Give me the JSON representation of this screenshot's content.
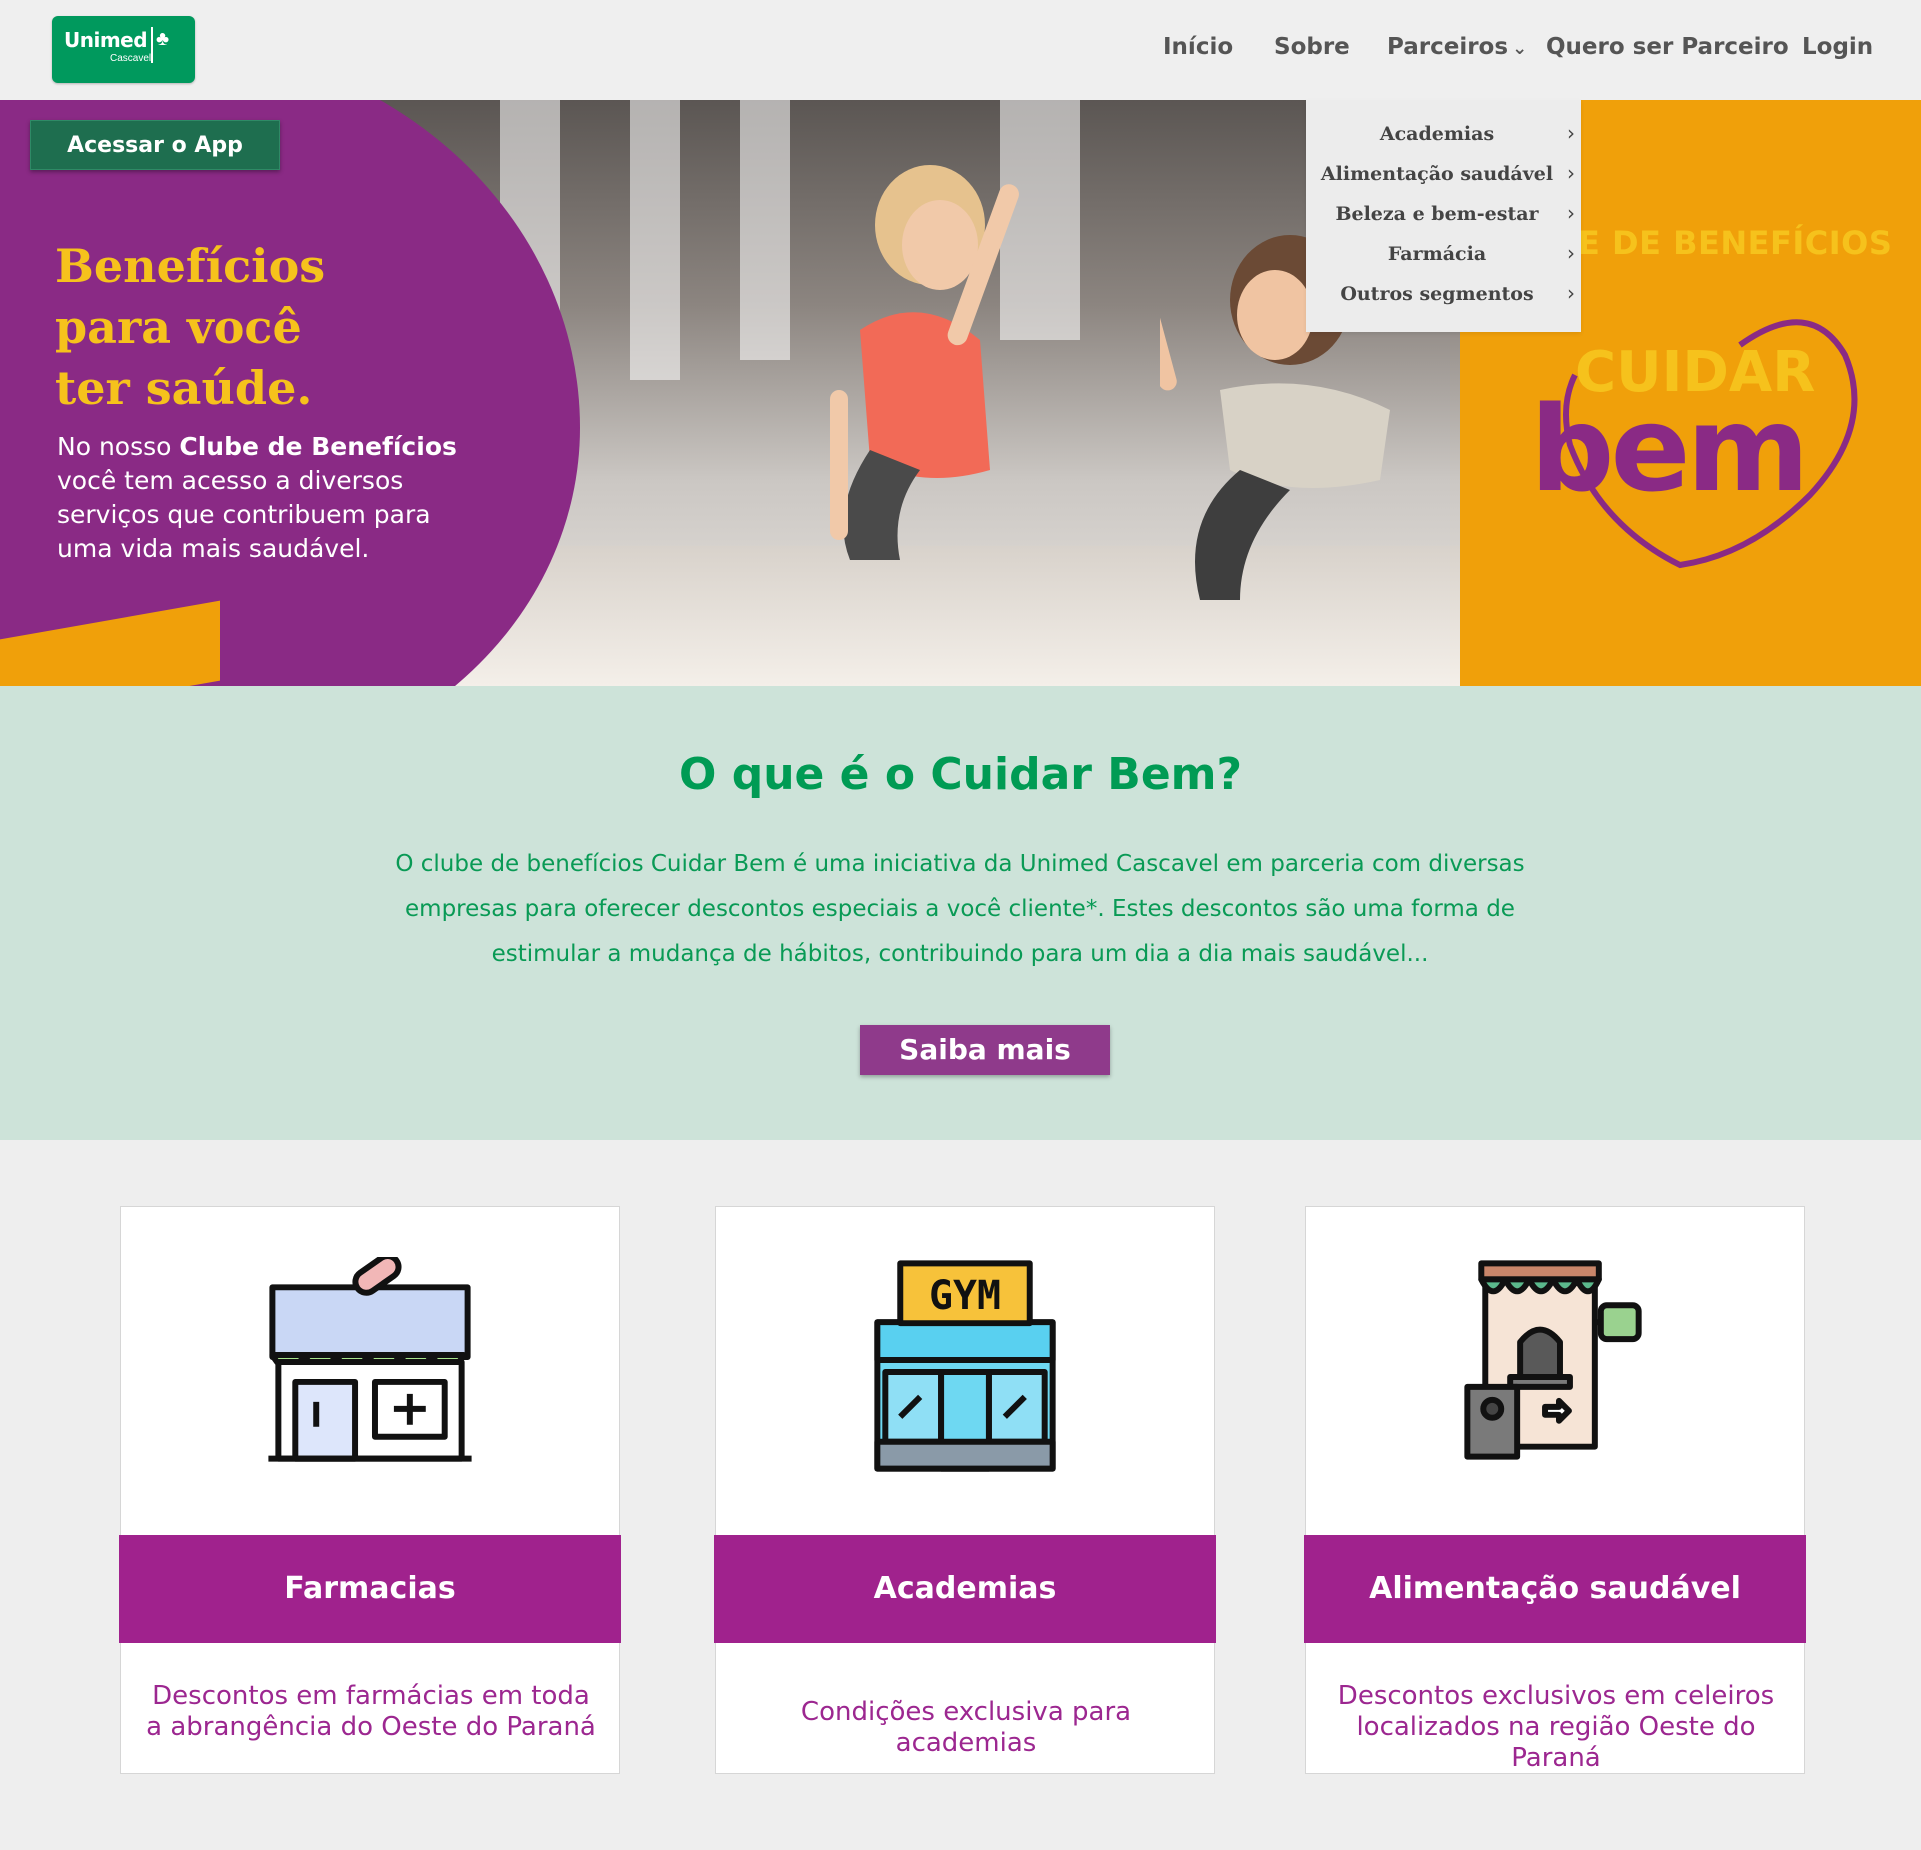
{
  "header": {
    "logo": {
      "brand": "Unimed",
      "city": "Cascavel"
    },
    "nav": [
      {
        "label": "Início"
      },
      {
        "label": "Sobre"
      },
      {
        "label": "Parceiros"
      },
      {
        "label": "Quero ser Parceiro"
      },
      {
        "label": "Login"
      }
    ],
    "dropdown": [
      {
        "label": "Academias"
      },
      {
        "label": "Alimentação saudável"
      },
      {
        "label": "Beleza e bem-estar"
      },
      {
        "label": "Farmácia"
      },
      {
        "label": "Outros segmentos"
      }
    ]
  },
  "hero": {
    "app_button": "Acessar o App",
    "title_line1": "Benefícios",
    "title_line2": "para você",
    "title_line3": "ter saúde.",
    "text_before": "No nosso ",
    "text_bold": "Clube de Benefícios",
    "text_after": " você tem acesso a diversos serviços que contribuem para uma vida mais saudável.",
    "club_label": "E DE BENEFÍCIOS",
    "logo_cuidar": "CUIDAR",
    "logo_bem": "bem"
  },
  "about": {
    "title": "O que é o Cuidar Bem?",
    "text": "O clube de benefícios Cuidar Bem é uma iniciativa da Unimed Cascavel em parceria com diversas empresas para oferecer descontos especiais a você cliente*. Estes descontos são uma forma de estimular a mudança de hábitos, contribuindo para um dia a dia mais saudável...",
    "button": "Saiba mais"
  },
  "cards": [
    {
      "title": "Farmacias",
      "description": "Descontos em farmácias em toda a abrangência do Oeste do Paraná",
      "icon": "pharmacy-icon"
    },
    {
      "title": "Academias",
      "description": "Condições exclusiva para academias",
      "icon": "gym-icon",
      "sign": "GYM"
    },
    {
      "title": "Alimentação saudável",
      "description": "Descontos exclusivos em celeiros localizados na região Oeste do Paraná",
      "icon": "store-icon"
    }
  ],
  "colors": {
    "brand_green": "#00995d",
    "purple": "#a0228d",
    "orange": "#f0a00a",
    "about_bg": "#cde3d9"
  }
}
